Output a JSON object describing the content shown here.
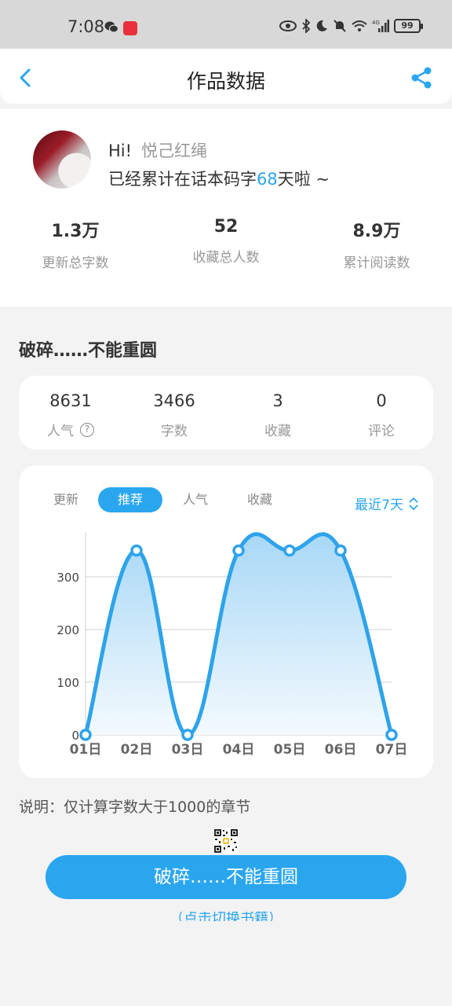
{
  "status_bar": {
    "time": "7:08",
    "app_badge": "小红书",
    "battery": "99",
    "network": "4G"
  },
  "header": {
    "title": "作品数据",
    "back_icon": "chevron-left-icon",
    "share_icon": "share-icon"
  },
  "profile": {
    "hi": "Hi!",
    "username": "悦己红绳",
    "days_prefix": "已经累计在话本码字",
    "days": "68",
    "days_suffix": "天啦 ~",
    "stats": [
      {
        "value": "1.3万",
        "label": "更新总字数"
      },
      {
        "value": "52",
        "label": "收藏总人数"
      },
      {
        "value": "8.9万",
        "label": "累计阅读数"
      }
    ]
  },
  "book": {
    "title": "破碎……不能重圆",
    "counts": [
      {
        "value": "8631",
        "label": "人气",
        "help": "?"
      },
      {
        "value": "3466",
        "label": "字数"
      },
      {
        "value": "3",
        "label": "收藏"
      },
      {
        "value": "0",
        "label": "评论"
      }
    ]
  },
  "chart_tabs": {
    "tabs": [
      "更新",
      "推荐",
      "人气",
      "收藏"
    ],
    "active": "推荐",
    "range": "最近7天"
  },
  "colors": {
    "accent": "#2aa6ef",
    "line": "#2ea3ea",
    "area_top": "#a8d8f6",
    "area_bottom": "#f4fafe"
  },
  "chart_data": {
    "type": "area",
    "x": [
      "01日",
      "02日",
      "03日",
      "04日",
      "05日",
      "06日",
      "07日"
    ],
    "series": [
      {
        "values": [
          0,
          350,
          0,
          350,
          350,
          350,
          0
        ]
      }
    ],
    "yticks": [
      0,
      100,
      200,
      300
    ],
    "ylim": [
      0,
      385
    ],
    "grid": true,
    "smooth": true
  },
  "note": "说明：仅计算字数大于1000的章节",
  "book_button": "破碎……不能重圆",
  "switch_hint": "（点击切换书籍）"
}
